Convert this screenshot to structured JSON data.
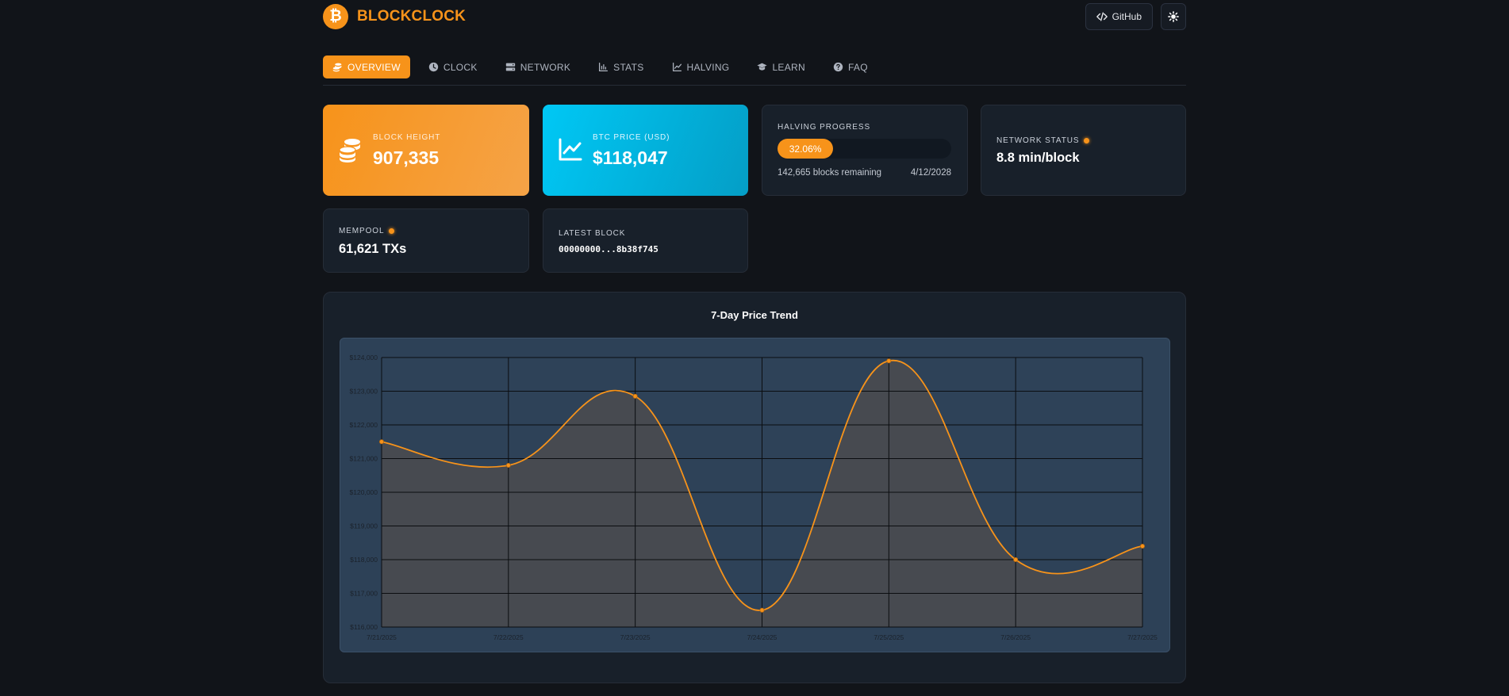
{
  "brand": {
    "logo_glyph": "₿",
    "name": "BLOCKCLOCK",
    "color": "#f7931a"
  },
  "header": {
    "github_label": "GitHub",
    "theme_icon": "sun-icon"
  },
  "tabs": [
    {
      "label": "OVERVIEW",
      "icon": "coins-icon",
      "active": true
    },
    {
      "label": "CLOCK",
      "icon": "clock-icon",
      "active": false
    },
    {
      "label": "NETWORK",
      "icon": "server-icon",
      "active": false
    },
    {
      "label": "STATS",
      "icon": "bar-chart-icon",
      "active": false
    },
    {
      "label": "HALVING",
      "icon": "line-chart-icon",
      "active": false
    },
    {
      "label": "LEARN",
      "icon": "graduation-cap-icon",
      "active": false
    },
    {
      "label": "FAQ",
      "icon": "question-icon",
      "active": false
    }
  ],
  "stats": {
    "block_height": {
      "label": "BLOCK HEIGHT",
      "value": "907,335"
    },
    "btc_price": {
      "label": "BTC PRICE (USD)",
      "value": "$118,047"
    },
    "halving": {
      "label": "HALVING PROGRESS",
      "percent_text": "32.06%",
      "percent": 32.06,
      "remaining": "142,665 blocks remaining",
      "date": "4/12/2028"
    },
    "network": {
      "label": "NETWORK STATUS",
      "value": "8.8 min/block"
    },
    "mempool": {
      "label": "MEMPOOL",
      "value": "61,621 TXs"
    },
    "latest_block": {
      "label": "LATEST BLOCK",
      "value": "00000000...8b38f745"
    }
  },
  "chart_data": {
    "type": "area",
    "title": "7-Day Price Trend",
    "x": [
      "7/21/2025",
      "7/22/2025",
      "7/23/2025",
      "7/24/2025",
      "7/25/2025",
      "7/26/2025",
      "7/27/2025"
    ],
    "series": [
      {
        "values": [
          121500,
          120800,
          122850,
          116500,
          123900,
          118000,
          118400
        ],
        "color": "#f7931a"
      }
    ],
    "yticks": [
      "$116,000",
      "$117,000",
      "$118,000",
      "$119,000",
      "$120,000",
      "$121,000",
      "$122,000",
      "$123,000",
      "$124,000"
    ],
    "ylim": [
      116000,
      124000
    ],
    "grid": true
  }
}
